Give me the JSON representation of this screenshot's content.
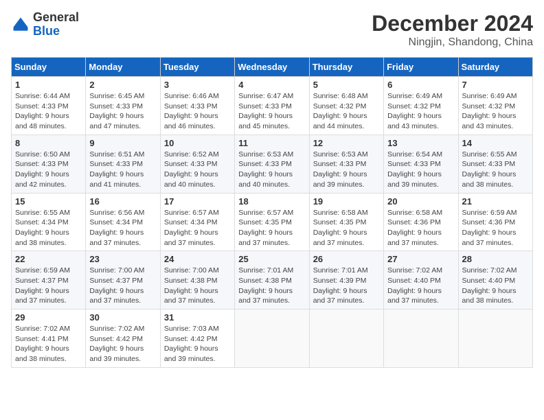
{
  "header": {
    "logo_general": "General",
    "logo_blue": "Blue",
    "month_title": "December 2024",
    "location": "Ningjin, Shandong, China"
  },
  "weekdays": [
    "Sunday",
    "Monday",
    "Tuesday",
    "Wednesday",
    "Thursday",
    "Friday",
    "Saturday"
  ],
  "weeks": [
    [
      {
        "day": "1",
        "sunrise": "6:44 AM",
        "sunset": "4:33 PM",
        "daylight": "9 hours and 48 minutes."
      },
      {
        "day": "2",
        "sunrise": "6:45 AM",
        "sunset": "4:33 PM",
        "daylight": "9 hours and 47 minutes."
      },
      {
        "day": "3",
        "sunrise": "6:46 AM",
        "sunset": "4:33 PM",
        "daylight": "9 hours and 46 minutes."
      },
      {
        "day": "4",
        "sunrise": "6:47 AM",
        "sunset": "4:33 PM",
        "daylight": "9 hours and 45 minutes."
      },
      {
        "day": "5",
        "sunrise": "6:48 AM",
        "sunset": "4:32 PM",
        "daylight": "9 hours and 44 minutes."
      },
      {
        "day": "6",
        "sunrise": "6:49 AM",
        "sunset": "4:32 PM",
        "daylight": "9 hours and 43 minutes."
      },
      {
        "day": "7",
        "sunrise": "6:49 AM",
        "sunset": "4:32 PM",
        "daylight": "9 hours and 43 minutes."
      }
    ],
    [
      {
        "day": "8",
        "sunrise": "6:50 AM",
        "sunset": "4:33 PM",
        "daylight": "9 hours and 42 minutes."
      },
      {
        "day": "9",
        "sunrise": "6:51 AM",
        "sunset": "4:33 PM",
        "daylight": "9 hours and 41 minutes."
      },
      {
        "day": "10",
        "sunrise": "6:52 AM",
        "sunset": "4:33 PM",
        "daylight": "9 hours and 40 minutes."
      },
      {
        "day": "11",
        "sunrise": "6:53 AM",
        "sunset": "4:33 PM",
        "daylight": "9 hours and 40 minutes."
      },
      {
        "day": "12",
        "sunrise": "6:53 AM",
        "sunset": "4:33 PM",
        "daylight": "9 hours and 39 minutes."
      },
      {
        "day": "13",
        "sunrise": "6:54 AM",
        "sunset": "4:33 PM",
        "daylight": "9 hours and 39 minutes."
      },
      {
        "day": "14",
        "sunrise": "6:55 AM",
        "sunset": "4:33 PM",
        "daylight": "9 hours and 38 minutes."
      }
    ],
    [
      {
        "day": "15",
        "sunrise": "6:55 AM",
        "sunset": "4:34 PM",
        "daylight": "9 hours and 38 minutes."
      },
      {
        "day": "16",
        "sunrise": "6:56 AM",
        "sunset": "4:34 PM",
        "daylight": "9 hours and 37 minutes."
      },
      {
        "day": "17",
        "sunrise": "6:57 AM",
        "sunset": "4:34 PM",
        "daylight": "9 hours and 37 minutes."
      },
      {
        "day": "18",
        "sunrise": "6:57 AM",
        "sunset": "4:35 PM",
        "daylight": "9 hours and 37 minutes."
      },
      {
        "day": "19",
        "sunrise": "6:58 AM",
        "sunset": "4:35 PM",
        "daylight": "9 hours and 37 minutes."
      },
      {
        "day": "20",
        "sunrise": "6:58 AM",
        "sunset": "4:36 PM",
        "daylight": "9 hours and 37 minutes."
      },
      {
        "day": "21",
        "sunrise": "6:59 AM",
        "sunset": "4:36 PM",
        "daylight": "9 hours and 37 minutes."
      }
    ],
    [
      {
        "day": "22",
        "sunrise": "6:59 AM",
        "sunset": "4:37 PM",
        "daylight": "9 hours and 37 minutes."
      },
      {
        "day": "23",
        "sunrise": "7:00 AM",
        "sunset": "4:37 PM",
        "daylight": "9 hours and 37 minutes."
      },
      {
        "day": "24",
        "sunrise": "7:00 AM",
        "sunset": "4:38 PM",
        "daylight": "9 hours and 37 minutes."
      },
      {
        "day": "25",
        "sunrise": "7:01 AM",
        "sunset": "4:38 PM",
        "daylight": "9 hours and 37 minutes."
      },
      {
        "day": "26",
        "sunrise": "7:01 AM",
        "sunset": "4:39 PM",
        "daylight": "9 hours and 37 minutes."
      },
      {
        "day": "27",
        "sunrise": "7:02 AM",
        "sunset": "4:40 PM",
        "daylight": "9 hours and 37 minutes."
      },
      {
        "day": "28",
        "sunrise": "7:02 AM",
        "sunset": "4:40 PM",
        "daylight": "9 hours and 38 minutes."
      }
    ],
    [
      {
        "day": "29",
        "sunrise": "7:02 AM",
        "sunset": "4:41 PM",
        "daylight": "9 hours and 38 minutes."
      },
      {
        "day": "30",
        "sunrise": "7:02 AM",
        "sunset": "4:42 PM",
        "daylight": "9 hours and 39 minutes."
      },
      {
        "day": "31",
        "sunrise": "7:03 AM",
        "sunset": "4:42 PM",
        "daylight": "9 hours and 39 minutes."
      },
      null,
      null,
      null,
      null
    ]
  ]
}
